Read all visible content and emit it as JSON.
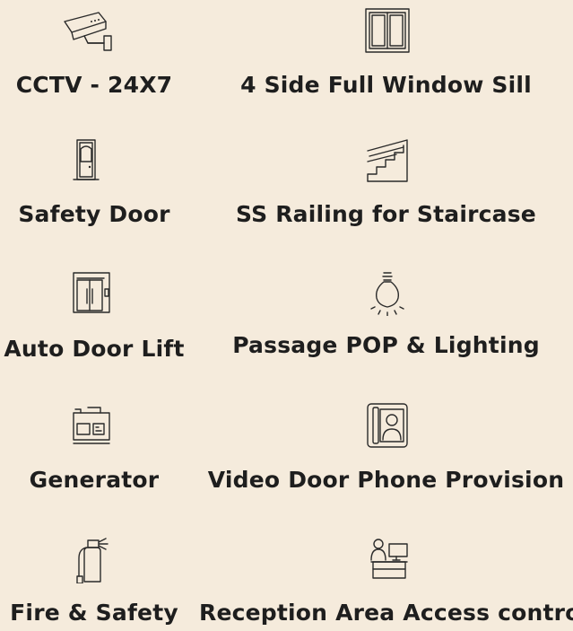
{
  "amenities": [
    {
      "label": "CCTV - 24X7",
      "icon": "cctv-camera-icon"
    },
    {
      "label": "4 Side Full Window Sill",
      "icon": "window-icon"
    },
    {
      "label": "Safety Door",
      "icon": "door-icon"
    },
    {
      "label": "SS Railing for Staircase",
      "icon": "staircase-icon"
    },
    {
      "label": "Auto Door Lift",
      "icon": "elevator-icon"
    },
    {
      "label": "Passage POP & Lighting",
      "icon": "light-bulb-icon"
    },
    {
      "label": "Generator",
      "icon": "generator-icon"
    },
    {
      "label": "Video Door Phone Provision",
      "icon": "video-door-phone-icon"
    },
    {
      "label": "Fire & Safety",
      "icon": "fire-extinguisher-icon"
    },
    {
      "label": "Reception Area Access control",
      "icon": "reception-desk-icon"
    }
  ]
}
